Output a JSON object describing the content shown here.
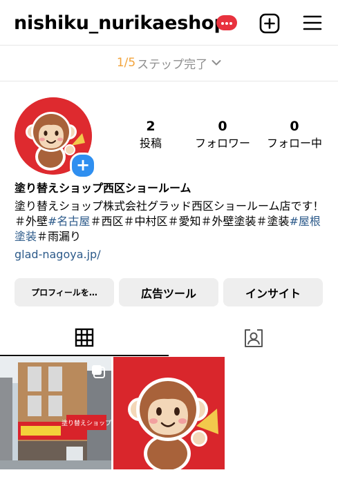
{
  "header": {
    "username": "nishiku_nurikaeshop",
    "notification_badge": "more-dots-icon",
    "create_icon": "plus-square-icon",
    "menu_icon": "hamburger-menu-icon"
  },
  "steps": {
    "fraction": "1/5",
    "label": "ステップ完了"
  },
  "profile": {
    "stats": [
      {
        "value": "2",
        "label": "投稿"
      },
      {
        "value": "0",
        "label": "フォロワー"
      },
      {
        "value": "0",
        "label": "フォロー中"
      }
    ],
    "name": "塗り替えショップ西区ショールーム",
    "bio_parts": [
      {
        "text": "塗り替えショップ株式会社グラッド西区ショールーム店です！＃外壁",
        "tag": false
      },
      {
        "text": "#名古屋",
        "tag": true
      },
      {
        "text": "＃西区＃中村区＃愛知＃外壁塗装＃塗装",
        "tag": false
      },
      {
        "text": "#屋根塗装",
        "tag": true
      },
      {
        "text": "＃雨漏り",
        "tag": false
      }
    ],
    "link": "glad-nagoya.jp/"
  },
  "buttons": {
    "edit_profile": "プロフィールを…",
    "ad_tools": "広告ツール",
    "insights": "インサイト"
  },
  "tabs": {
    "grid_icon": "grid-icon",
    "tagged_icon": "tagged-person-icon"
  },
  "posts": [
    {
      "kind": "storefront-photo",
      "sign_text": "塗り替えショップ",
      "is_carousel": true
    },
    {
      "kind": "monkey-mascot-illustration",
      "is_carousel": false
    }
  ],
  "colors": {
    "accent_orange": "#f2a33a",
    "link_blue": "#2c5a8a",
    "badge_red": "#e8323e",
    "story_blue": "#2f8ff0",
    "brand_red": "#de2a2f"
  }
}
